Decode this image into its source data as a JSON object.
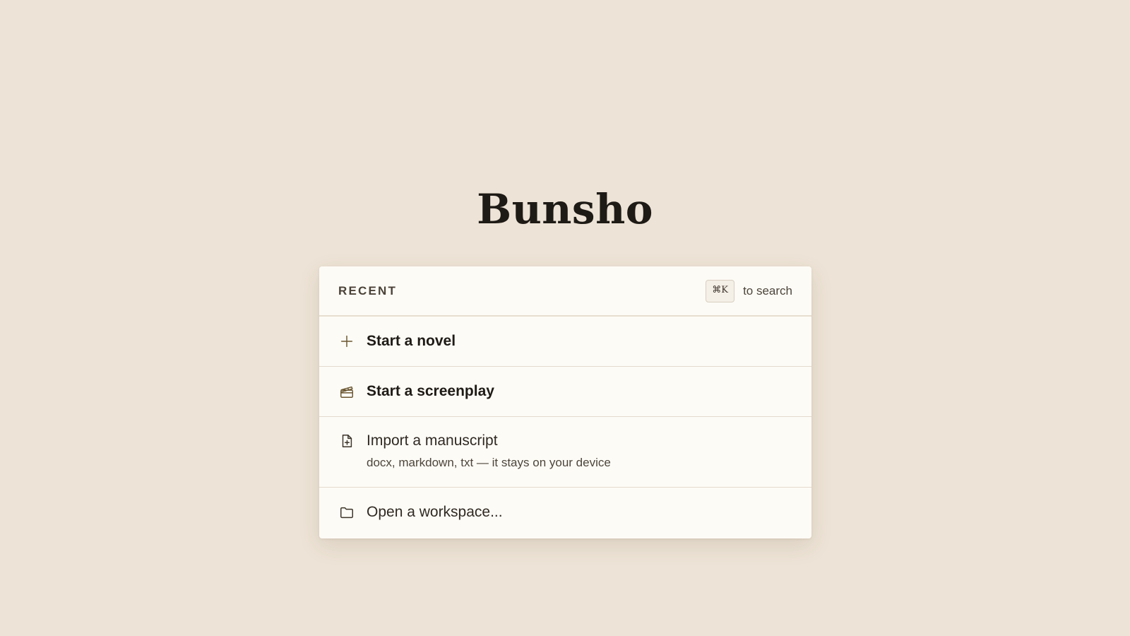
{
  "app": {
    "title": "Bunsho"
  },
  "panel": {
    "header": {
      "label": "RECENT",
      "shortcut": "⌘K",
      "shortcut_hint": "to search"
    },
    "actions": [
      {
        "icon": "plus-icon",
        "label": "Start a novel"
      },
      {
        "icon": "clapperboard-icon",
        "label": "Start a screenplay"
      },
      {
        "icon": "file-plus-icon",
        "label": "Import a manuscript",
        "sublabel": "docx, markdown, txt — it stays on your device"
      },
      {
        "icon": "folder-icon",
        "label": "Open a workspace..."
      }
    ]
  },
  "colors": {
    "background": "#ede3d6",
    "panel": "#fdfbf6",
    "accent_icon": "#6b5630",
    "text": "#1e1a15"
  }
}
